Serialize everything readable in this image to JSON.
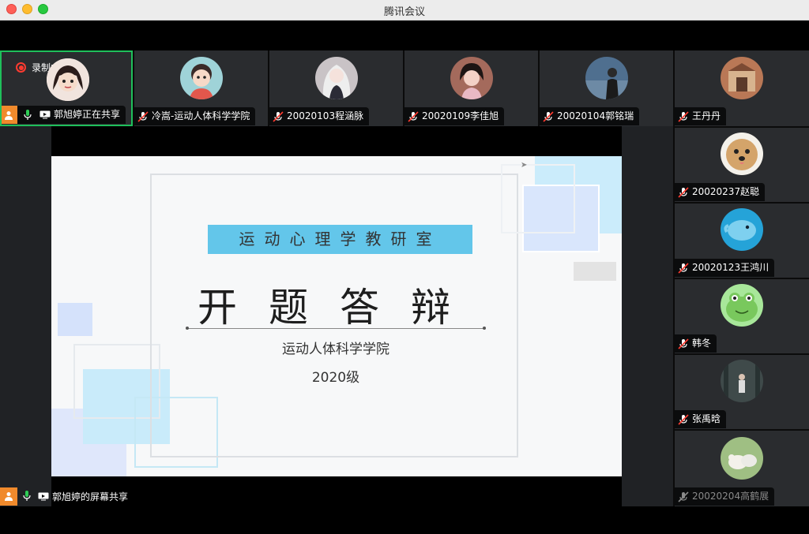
{
  "window": {
    "title": "腾讯会议"
  },
  "recording": {
    "label": "录制中"
  },
  "top_row": [
    {
      "name": "郭旭婷正在共享",
      "mic": "on",
      "sharing": true,
      "active": true
    },
    {
      "name": "冷嵩-运动人体科学学院",
      "mic": "muted"
    },
    {
      "name": "20020103程涵脉",
      "mic": "muted"
    },
    {
      "name": "20020109李佳旭",
      "mic": "muted"
    },
    {
      "name": "20020104郭铭瑞",
      "mic": "muted"
    },
    {
      "name": "王丹丹",
      "mic": "muted"
    }
  ],
  "side_column": [
    {
      "name": "20020237赵聪",
      "mic": "muted"
    },
    {
      "name": "20020123王鸿川",
      "mic": "muted"
    },
    {
      "name": "韩冬",
      "mic": "muted"
    },
    {
      "name": "张禹晗",
      "mic": "muted"
    },
    {
      "name": "20020204高鹤展",
      "mic": "muted",
      "dim": true
    }
  ],
  "slide": {
    "banner": "运动心理学教研室",
    "title": "开题答辩",
    "subtitle": "运动人体科学学院",
    "year": "2020级"
  },
  "share": {
    "label": "郭旭婷的屏幕共享"
  },
  "colors": {
    "active_border": "#1fbf5b",
    "banner": "#63c6ea",
    "presenter_badge": "#f08a2c"
  }
}
